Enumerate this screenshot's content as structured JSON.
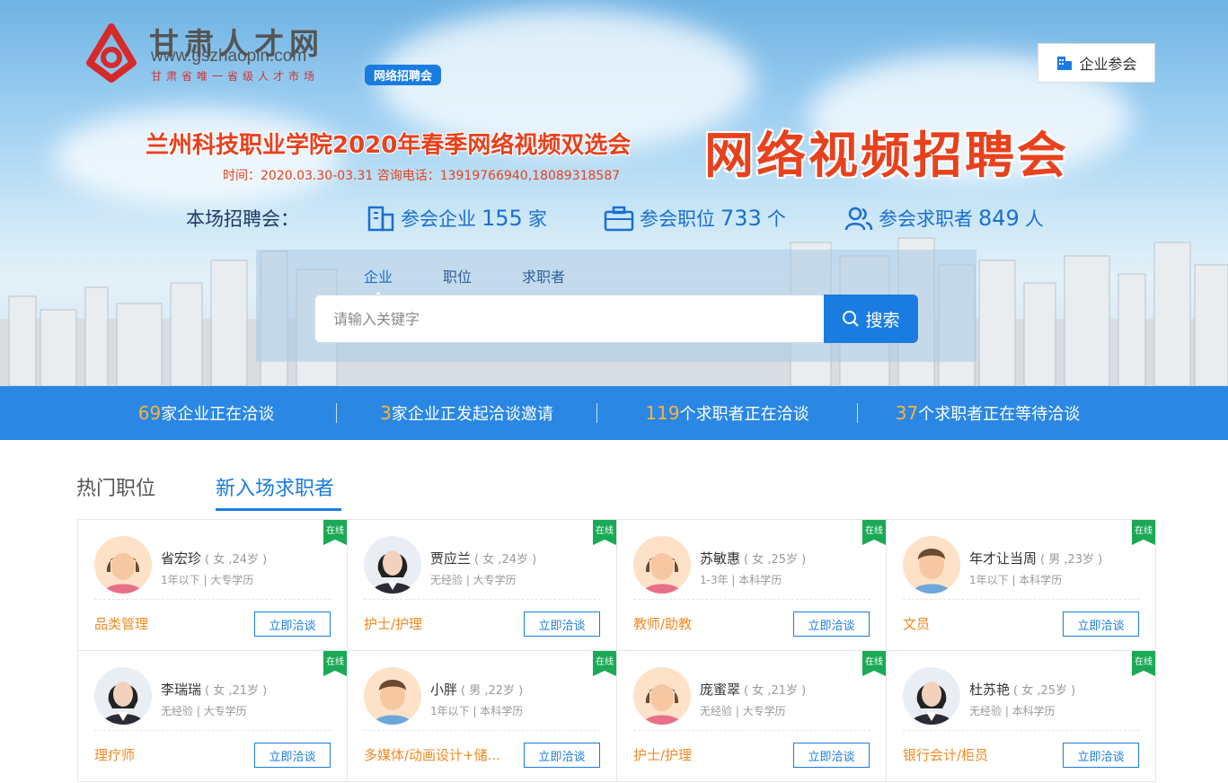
{
  "header": {
    "logo_cn": "甘肃人才网",
    "logo_url": "www.gszhaopin.com",
    "logo_sub": "甘肃省唯一省级人才市场",
    "logo_badge": "网络招聘会",
    "join_button": "企业参会"
  },
  "banner": {
    "headline": "兰州科技职业学院2020年春季网络视频双选会",
    "big_title": "网络视频招聘会",
    "time_info": "时间：2020.03.30-03.31 咨询电话：13919766940,18089318587"
  },
  "stats": {
    "label": "本场招聘会：",
    "companies_prefix": "参会企业",
    "companies_num": "155",
    "companies_unit": "家",
    "positions_prefix": "参会职位",
    "positions_num": "733",
    "positions_unit": "个",
    "seekers_prefix": "参会求职者",
    "seekers_num": "849",
    "seekers_unit": "人"
  },
  "search": {
    "tabs": [
      "企业",
      "职位",
      "求职者"
    ],
    "active_tab": "企业",
    "placeholder": "请输入关键字",
    "button": "搜索"
  },
  "live_bar": [
    {
      "num": "69",
      "text": "家企业正在洽谈"
    },
    {
      "num": "3",
      "text": "家企业正发起洽谈邀请"
    },
    {
      "num": "119",
      "text": "个求职者正在洽谈"
    },
    {
      "num": "37",
      "text": "个求职者正在等待洽谈"
    }
  ],
  "section_tabs": {
    "hot_jobs": "热门职位",
    "new_seekers": "新入场求职者"
  },
  "online_label": "在线",
  "talk_button": "立即洽谈",
  "seekers": [
    {
      "name": "省宏珍",
      "meta": "( 女 ,24岁 )",
      "exp": "1年以下 | 大专学历",
      "job": "品类管理",
      "avatar": "female-cartoon"
    },
    {
      "name": "贾应兰",
      "meta": "( 女 ,24岁 )",
      "exp": "无经验 | 大专学历",
      "job": "护士/护理",
      "avatar": "photo"
    },
    {
      "name": "苏敏惠",
      "meta": "( 女 ,25岁 )",
      "exp": "1-3年 | 本科学历",
      "job": "教师/助教",
      "avatar": "female-cartoon"
    },
    {
      "name": "年才让当周",
      "meta": "( 男 ,23岁 )",
      "exp": "1年以下 | 本科学历",
      "job": "文员",
      "avatar": "male-cartoon"
    },
    {
      "name": "李瑞瑞",
      "meta": "( 女 ,21岁 )",
      "exp": "无经验 | 大专学历",
      "job": "理疗师",
      "avatar": "photo"
    },
    {
      "name": "小胖",
      "meta": "( 男 ,22岁 )",
      "exp": "1年以下 | 本科学历",
      "job": "多媒体/动画设计+储...",
      "avatar": "male-cartoon"
    },
    {
      "name": "庞蜜翠",
      "meta": "( 女 ,21岁 )",
      "exp": "无经验 | 大专学历",
      "job": "护士/护理",
      "avatar": "female-cartoon"
    },
    {
      "name": "杜苏艳",
      "meta": "( 女 ,25岁 )",
      "exp": "无经验 | 本科学历",
      "job": "银行会计/柜员",
      "avatar": "photo"
    }
  ],
  "colors": {
    "brand_blue": "#1a7ce0",
    "bar_blue": "#2a87e4",
    "accent_orange": "#f08a24",
    "headline_red": "#e8411e",
    "online_green": "#1aaa55"
  }
}
